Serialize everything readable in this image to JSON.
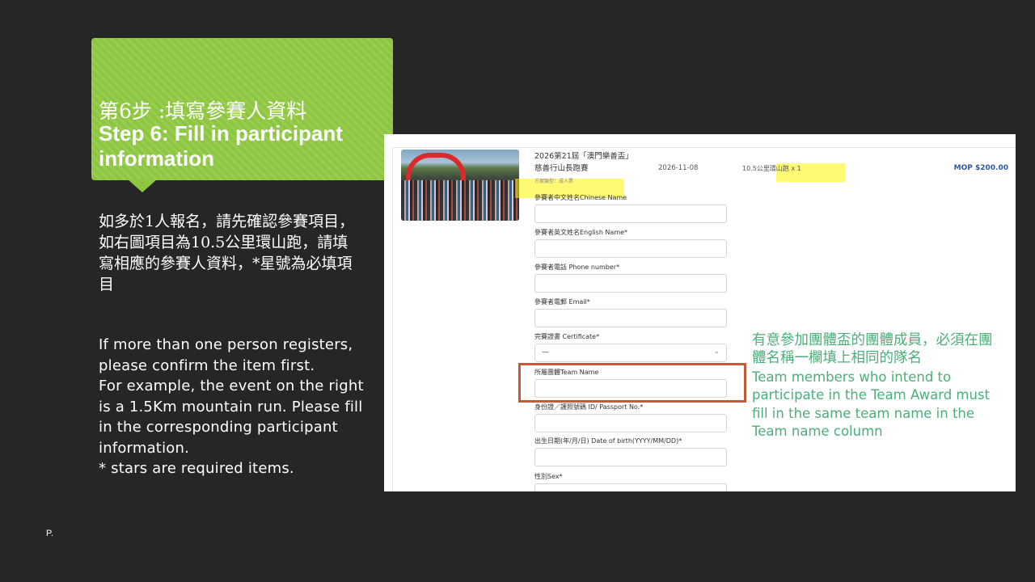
{
  "header": {
    "title_zh": "第6步 :填寫參賽人資料",
    "title_en": "Step 6: Fill in participant information"
  },
  "instructions": {
    "zh": "如多於1人報名，請先確認參賽項目，如右圖項目為10.5公里環山跑，請填寫相應的參賽人資料，*星號為必填項目",
    "en_lines": [
      "If more than one person registers, please confirm the item first.",
      "For example, the event on the right is a 1.5Km mountain run. Please fill in the corresponding participant information.",
      "* stars are required items."
    ]
  },
  "page_label": "P.",
  "cart_item": {
    "event_name": "2026第21屆「澳門樂善盃」慈善行山長跑賽",
    "event_type": "方案類型：成人票",
    "date": "2026-11-08",
    "item": "10.5公里環山跑 x 1",
    "price": "MOP $200.00"
  },
  "form": {
    "fields": [
      {
        "label": "參賽者中文姓名Chinese Name",
        "value": ""
      },
      {
        "label": "參賽者英文姓名English Name*",
        "value": ""
      },
      {
        "label": "參賽者電話 Phone number*",
        "value": ""
      },
      {
        "label": "參賽者電郵 Email*",
        "value": ""
      },
      {
        "label": "完賽證書 Certificate*",
        "value": "—"
      },
      {
        "label": "所屬團體Team Name",
        "value": ""
      },
      {
        "label": "身份證／護照號碼 ID/ Passport No.*",
        "value": ""
      },
      {
        "label": "出生日期(年/月/日) Date of birth(YYYY/MM/DD)*",
        "value": ""
      },
      {
        "label": "性別Sex*",
        "value": ""
      }
    ]
  },
  "annotation": {
    "zh": "有意參加團體盃的團體成員，必須在團體名稱一欄填上相同的隊名",
    "en": "Team members who intend to participate in the Team Award must fill in the same team name in the Team name column"
  },
  "colors": {
    "header_green": "#8dc63f",
    "annotation_green": "#4caf7a",
    "highlight_red": "#c55a3b",
    "price_blue": "#2a5aa8"
  }
}
